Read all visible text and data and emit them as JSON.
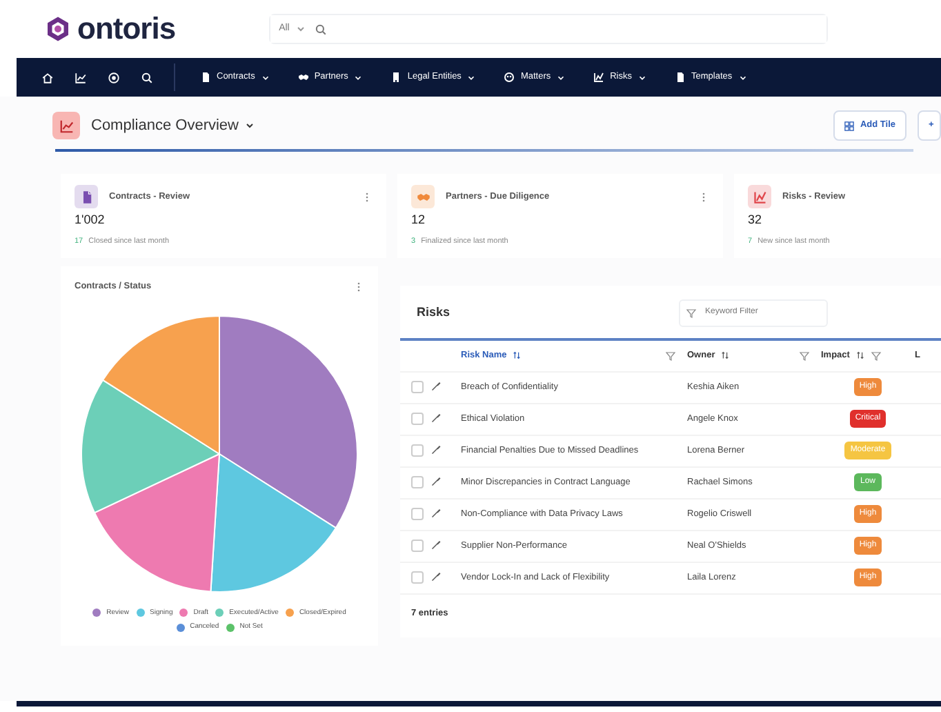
{
  "logo": {
    "text": "ontoris"
  },
  "search": {
    "scope": "All"
  },
  "nav": {
    "items": [
      {
        "label": "Contracts",
        "kind": "doc"
      },
      {
        "label": "Partners",
        "kind": "handshake"
      },
      {
        "label": "Legal Entities",
        "kind": "building"
      },
      {
        "label": "Matters",
        "kind": "people"
      },
      {
        "label": "Risks",
        "kind": "risk"
      },
      {
        "label": "Templates",
        "kind": "doc"
      }
    ]
  },
  "dashboard": {
    "title": "Compliance Overview",
    "buttons": [
      {
        "label": "Add Tile",
        "kind": "grid"
      },
      {
        "label": "+",
        "kind": "plain"
      }
    ]
  },
  "kpis": [
    {
      "title": "Contracts - Review",
      "value": "1'002",
      "delta": "17",
      "note": "Closed since last month",
      "kind": "doc",
      "color": "#7a4fb0",
      "menu": true
    },
    {
      "title": "Partners - Due Diligence",
      "value": "12",
      "delta": "3",
      "note": "Finalized since last month",
      "kind": "handshake",
      "color": "#f08a3c",
      "menu": true
    },
    {
      "title": "Risks - Review",
      "value": "32",
      "delta": "7",
      "note": "New since last month",
      "kind": "risk",
      "color": "#e0464b",
      "menu": false
    }
  ],
  "pie_panel": {
    "title": "Contracts / Status",
    "legend": [
      {
        "label": "Review",
        "color": "#a07cc0"
      },
      {
        "label": "Signing",
        "color": "#5ec8e0"
      },
      {
        "label": "Draft",
        "color": "#ee7ab0"
      },
      {
        "label": "Executed/Active",
        "color": "#6ccfb8"
      },
      {
        "label": "Closed/Expired",
        "color": "#f7a14e"
      },
      {
        "label": "Canceled",
        "color": "#5b8fd8"
      },
      {
        "label": "Not Set",
        "color": "#5cc26a"
      }
    ]
  },
  "risks": {
    "title": "Risks",
    "filter_placeholder": "Keyword Filter",
    "columns": [
      {
        "label": "Risk Name",
        "sorted": true
      },
      {
        "label": "Owner",
        "sorted": false
      },
      {
        "label": "Impact",
        "sorted": false
      },
      {
        "label": "L",
        "sorted": false
      }
    ],
    "rows": [
      {
        "name": "Breach of Confidentiality",
        "owner": "Keshia Aiken",
        "impact": "High",
        "color": "#ee8a3c",
        "checked": false
      },
      {
        "name": "Ethical Violation",
        "owner": "Angele Knox",
        "impact": "Critical",
        "color": "#e0302c",
        "checked": false
      },
      {
        "name": "Financial Penalties Due to Missed Deadlines",
        "owner": "Lorena Berner",
        "impact": "Moderate",
        "color": "#f5c542",
        "checked": false
      },
      {
        "name": "Minor Discrepancies in Contract Language",
        "owner": "Rachael Simons",
        "impact": "Low",
        "color": "#5cb85c",
        "checked": false
      },
      {
        "name": "Non-Compliance with Data Privacy Laws",
        "owner": "Rogelio Criswell",
        "impact": "High",
        "color": "#ee8a3c",
        "checked": false
      },
      {
        "name": "Supplier Non-Performance",
        "owner": "Neal O'Shields",
        "impact": "High",
        "color": "#ee8a3c",
        "checked": false
      },
      {
        "name": "Vendor Lock-In and Lack of Flexibility",
        "owner": "Laila Lorenz",
        "impact": "High",
        "color": "#ee8a3c",
        "checked": false
      }
    ],
    "footer": "7 entries"
  }
}
